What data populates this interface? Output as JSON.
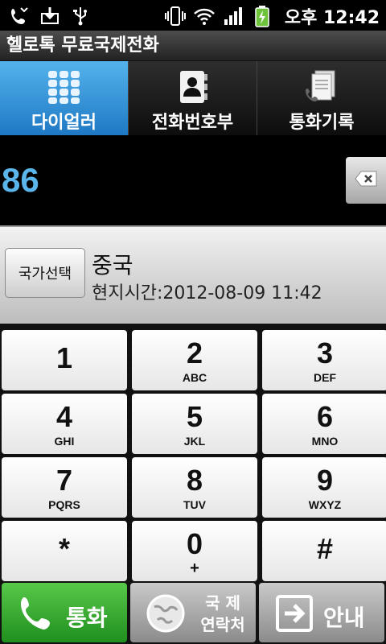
{
  "status_bar": {
    "time": "오후 12:42",
    "icons": [
      "missed-call-icon",
      "download-icon",
      "usb-icon",
      "vibrate-icon",
      "wifi-icon",
      "signal-icon",
      "battery-charging-icon"
    ]
  },
  "app_title": "헬로톡 무료국제전화",
  "tabs": [
    {
      "label": "다이얼러",
      "icon": "dialpad-icon",
      "active": true
    },
    {
      "label": "전화번호부",
      "icon": "contacts-icon",
      "active": false
    },
    {
      "label": "통화기록",
      "icon": "call-log-icon",
      "active": false
    }
  ],
  "dial_number": "86",
  "country": {
    "button_label": "국가선택",
    "name": "중국",
    "local_time": "현지시간:2012-08-09 11:42"
  },
  "keypad": [
    {
      "digit": "1",
      "letters": ""
    },
    {
      "digit": "2",
      "letters": "ABC"
    },
    {
      "digit": "3",
      "letters": "DEF"
    },
    {
      "digit": "4",
      "letters": "GHI"
    },
    {
      "digit": "5",
      "letters": "JKL"
    },
    {
      "digit": "6",
      "letters": "MNO"
    },
    {
      "digit": "7",
      "letters": "PQRS"
    },
    {
      "digit": "8",
      "letters": "TUV"
    },
    {
      "digit": "9",
      "letters": "WXYZ"
    },
    {
      "digit": "*",
      "letters": ""
    },
    {
      "digit": "0",
      "letters": "+"
    },
    {
      "digit": "#",
      "letters": ""
    }
  ],
  "bottom": {
    "call_label": "통화",
    "intl_contacts_line1": "국 제",
    "intl_contacts_line2": "연락처",
    "guide_label": "안내"
  },
  "colors": {
    "accent_blue": "#3a9ae0",
    "number_blue": "#5ab6ea",
    "call_green": "#2fa82c"
  }
}
